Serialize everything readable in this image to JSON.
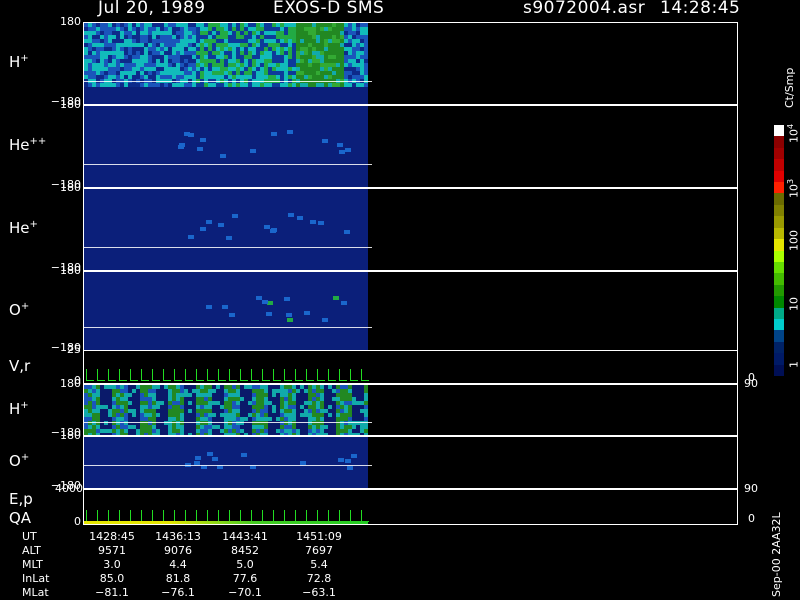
{
  "header": {
    "date": "Jul 20, 1989",
    "instrument": "EXOS-D SMS",
    "file": "s9072004.asr",
    "time": "14:28:45"
  },
  "panels": [
    {
      "species": "H",
      "charge": "+",
      "top": "180",
      "bottom": "−180"
    },
    {
      "species": "He",
      "charge": "++",
      "top": "180",
      "bottom": "−180"
    },
    {
      "species": "He",
      "charge": "+",
      "top": "180",
      "bottom": "−180"
    },
    {
      "species": "O",
      "charge": "+",
      "top": "180",
      "bottom": "−180"
    },
    {
      "species": "V,r",
      "charge": "",
      "top": "25",
      "bottom": "0",
      "right_top": "90",
      "right_bottom": "0"
    },
    {
      "species": "H",
      "charge": "+",
      "top": "180",
      "bottom": "−180"
    },
    {
      "species": "O",
      "charge": "+",
      "top": "180",
      "bottom": "−180",
      "right_top": "90"
    },
    {
      "species": "E,p",
      "charge": "",
      "species2": "QA",
      "top": "4000",
      "bottom": "0",
      "right_bottom": "0"
    }
  ],
  "colorbar": {
    "title": "Ct/Smp",
    "ticks": [
      {
        "base": "10",
        "exp": "4"
      },
      {
        "base": "10",
        "exp": "3"
      },
      {
        "base": "100",
        "exp": ""
      },
      {
        "base": "10",
        "exp": ""
      },
      {
        "base": "1",
        "exp": ""
      }
    ],
    "colors": [
      "#ffffff",
      "#8b0000",
      "#a00000",
      "#c00000",
      "#e00000",
      "#ff2000",
      "#6b6b00",
      "#808000",
      "#999900",
      "#b8b800",
      "#e6e600",
      "#aaff00",
      "#66dd00",
      "#44bb00",
      "#229900",
      "#008800",
      "#00aa88",
      "#00cccc",
      "#004488",
      "#002266",
      "#001a66",
      "#000f55"
    ]
  },
  "footer": {
    "rows": [
      {
        "label": "UT",
        "values": [
          "1428:45",
          "1436:13",
          "1443:41",
          "1451:09"
        ]
      },
      {
        "label": "ALT",
        "values": [
          "9571",
          "9076",
          "8452",
          "7697"
        ]
      },
      {
        "label": "MLT",
        "values": [
          "3.0",
          "4.4",
          "5.0",
          "5.4"
        ]
      },
      {
        "label": "InLat",
        "values": [
          "85.0",
          "81.8",
          "77.6",
          "72.8"
        ]
      },
      {
        "label": "MLat",
        "values": [
          "−81.1",
          "−76.1",
          "−70.1",
          "−63.1"
        ]
      }
    ],
    "version": "Sep-00 2AA32L"
  },
  "chart_data": {
    "type": "heatmap",
    "title": "Jul 20, 1989   EXOS-D SMS",
    "x": [
      "1428:45",
      "1436:13",
      "1443:41",
      "1451:09"
    ],
    "panels": [
      "H+",
      "He++",
      "He+",
      "O+",
      "V,r",
      "H+",
      "O+",
      "E,p QA"
    ],
    "y_range": [
      -180,
      180
    ],
    "colorbar": {
      "label": "Ct/Smp",
      "ticks": [
        10000,
        1000,
        100,
        10,
        1
      ],
      "scale": "log"
    }
  }
}
